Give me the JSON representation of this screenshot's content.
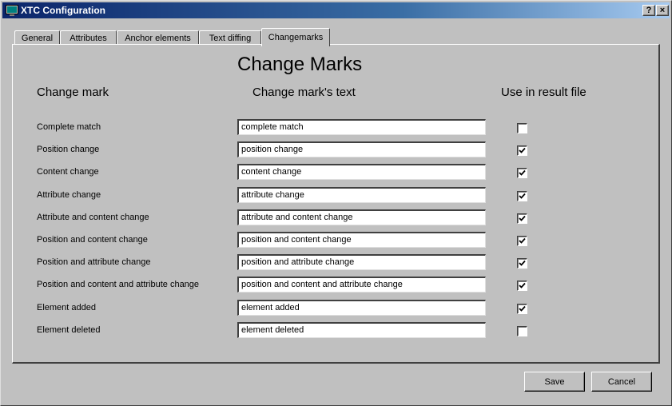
{
  "window": {
    "title": "XTC Configuration",
    "help_label": "?",
    "close_label": "×"
  },
  "tabs": [
    {
      "label": "General",
      "active": false
    },
    {
      "label": "Attributes",
      "active": false
    },
    {
      "label": "Anchor elements",
      "active": false
    },
    {
      "label": "Text diffing",
      "active": false
    },
    {
      "label": "Changemarks",
      "active": true
    }
  ],
  "panel": {
    "title": "Change Marks",
    "col_change_mark": "Change mark",
    "col_text": "Change mark's text",
    "col_use": "Use in result file",
    "rows": [
      {
        "label": "Complete match",
        "text": "complete match",
        "checked": false
      },
      {
        "label": "Position change",
        "text": "position change",
        "checked": true
      },
      {
        "label": "Content change",
        "text": "content change",
        "checked": true
      },
      {
        "label": "Attribute change",
        "text": "attribute change",
        "checked": true
      },
      {
        "label": "Attribute and content change",
        "text": "attribute and content change",
        "checked": true
      },
      {
        "label": "Position and content change",
        "text": "position and content change",
        "checked": true
      },
      {
        "label": "Position and attribute change",
        "text": "position and attribute change",
        "checked": true
      },
      {
        "label": "Position and content and attribute change",
        "text": "position and content and attribute change",
        "checked": true
      },
      {
        "label": "Element added",
        "text": "element added",
        "checked": true
      },
      {
        "label": "Element deleted",
        "text": "element deleted",
        "checked": false
      }
    ]
  },
  "buttons": {
    "save": "Save",
    "cancel": "Cancel"
  }
}
